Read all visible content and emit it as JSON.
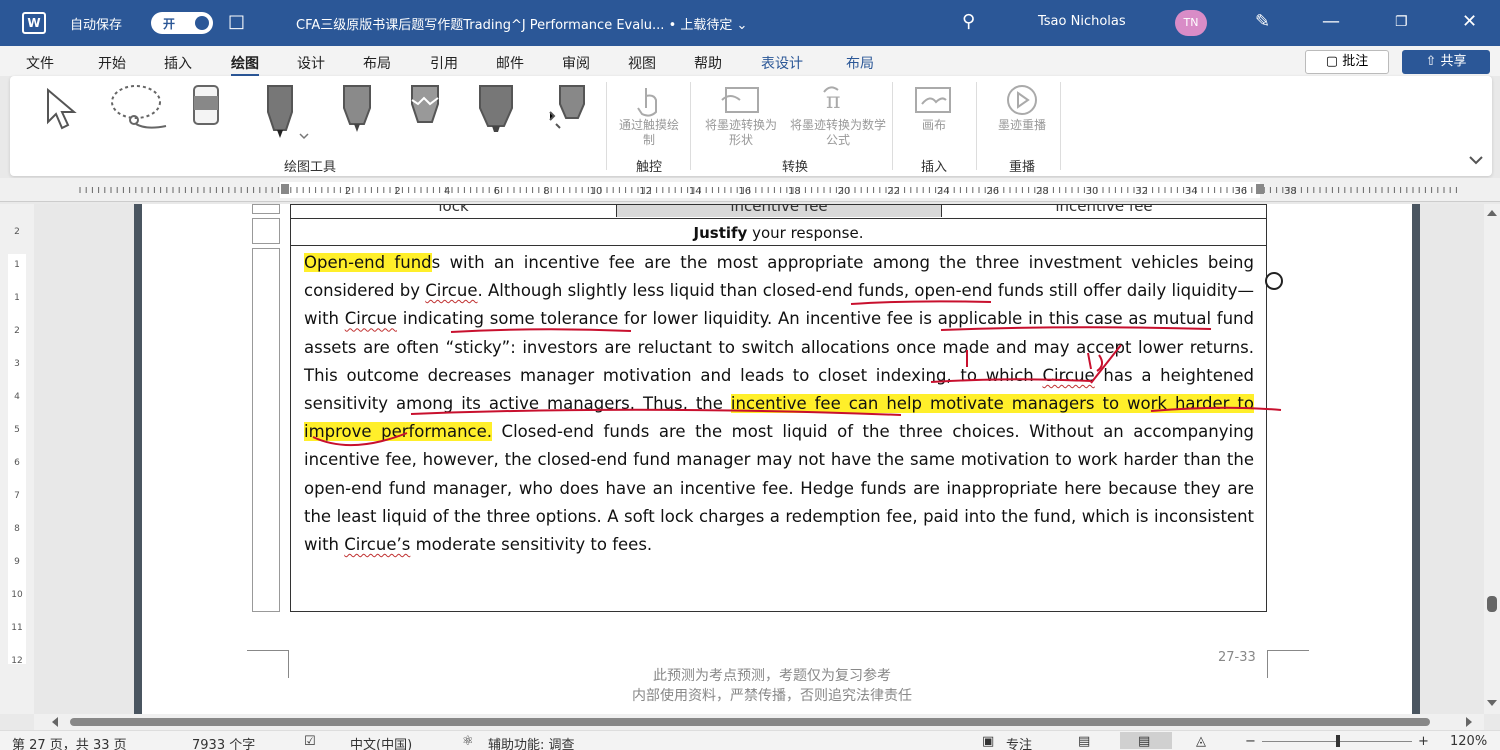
{
  "titlebar": {
    "autosave_label": "自动保存",
    "autosave_state": "开",
    "doc_title": "CFA三级原版书课后题写作题Trading^J Performance Evalu... • 上载待定 ⌄",
    "user_name": "Tsao Nicholas",
    "user_initials": "TN"
  },
  "menu": {
    "tabs": [
      "文件",
      "开始",
      "插入",
      "绘图",
      "设计",
      "布局",
      "引用",
      "邮件",
      "审阅",
      "视图",
      "帮助",
      "表设计",
      "布局"
    ],
    "active_tab": "绘图",
    "comment_label": "批注",
    "share_label": "共享"
  },
  "ribbon": {
    "groups": {
      "drawing_tools": "绘图工具",
      "touch": "触控",
      "convert": "转换",
      "insert": "插入",
      "replay": "重播"
    },
    "touch_draw": "通过触摸绘制",
    "ink_to_shape": "将墨迹转换为形状",
    "ink_to_math": "将墨迹转换为数学公式",
    "canvas": "画布",
    "ink_replay": "墨迹重播"
  },
  "ruler": {
    "labels": [
      "2",
      "2",
      "4",
      "6",
      "8",
      "10",
      "12",
      "14",
      "16",
      "18",
      "20",
      "22",
      "24",
      "26",
      "28",
      "30",
      "32",
      "34",
      "36",
      "38"
    ],
    "vlabels": [
      "2",
      "1",
      "1",
      "2",
      "3",
      "4",
      "5",
      "6",
      "7",
      "8",
      "9",
      "10",
      "11",
      "12"
    ]
  },
  "document": {
    "top_cells": [
      "lock",
      "incentive fee",
      "incentive fee"
    ],
    "justify_bold": "Justify",
    "justify_rest": " your response.",
    "answer": {
      "p1_hl": "Open-end fund",
      "p2": "s with an incentive fee are the most appropriate among the three investment vehicles being considered by ",
      "circue1": "Circue",
      "p3": ". Although slightly less liquid than closed-end funds, open-end funds still offer daily liquidity—with ",
      "circue2": "Circue",
      "p4": " indicating some tolerance for lower liquidity. An incentive fee is applicable in this case as mutual fund assets are often “sticky”: investors are reluctant to switch allocations once made and may accept lower returns. This outcome decreases manager motivation and leads to closet indexing, to which ",
      "circue3": "Circue",
      "p5": " has a heightened sensitivity among its active managers. Thus, the ",
      "hl2": "incentive fee can help motivate managers to work harder to improve performance.",
      "p6": " Closed-end funds are the most liquid of the three choices. Without an accompanying incentive fee, however, the closed-end fund manager may not have the same motivation to work harder than the open-end fund manager, who does have an incentive fee. Hedge funds are inappropriate here because they are the least liquid of the three options. A soft lock charges a redemption fee, paid into the fund, which is inconsistent with ",
      "circue4": "Circue’s",
      "p7": " moderate sensitivity to fees."
    },
    "footer_line1": "此预测为考点预测，考题仅为复习参考",
    "footer_line2": "内部使用资料，严禁传播，否则追究法律责任",
    "page_number": "27-33"
  },
  "statusbar": {
    "page_info": "第 27 页，共 33 页",
    "word_count": "7933 个字",
    "language": "中文(中国)",
    "accessibility": "辅助功能: 调查",
    "focus": "专注",
    "zoom": "120%"
  },
  "colors": {
    "titlebar": "#2b5797",
    "highlight": "#ffef2a",
    "ink": "#c8102e"
  }
}
